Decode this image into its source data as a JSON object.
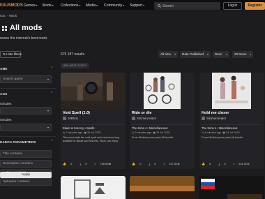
{
  "nav": {
    "logo": "EXUSMODS",
    "links": [
      "Games",
      "Mods",
      "Collections",
      "Media",
      "Community",
      "Support"
    ],
    "search_placeholder": "Search",
    "login": "Log in",
    "register": "Register"
  },
  "breadcrumb": [
    "ous",
    "Mods"
  ],
  "page": {
    "title": "All mods",
    "subtitle": "rowse the internet's best mods"
  },
  "toolbar": {
    "hide_filters": "Hide filters",
    "results": "675 187 results",
    "time": "All time",
    "sort_by": "Date Published",
    "order": "Desc",
    "per_page": "20 items"
  },
  "sidebar": {
    "game_label": "AME",
    "game_placeholder": "Search game",
    "tags_label": "AGS",
    "includes_1": "ncludes",
    "includes_2": "ncludes",
    "search_params_label": "EARCH PARAMETERS",
    "title_ph": "Title contains",
    "description_ph": "Description contains",
    "author_ph": "Author contains",
    "uploader_ph": "Uploader contains",
    "apply": "Apply"
  },
  "filter_chip": "Hide adult content",
  "cards": [
    {
      "title": "Void Spell (1.0)",
      "author": "10khtrix",
      "category": "Blade & Sorcery • Spells",
      "time": "2 minutes ago",
      "date": "24 Jul 2025",
      "desc": "This mod adds the void spell who has been long awaited for Blade and Sorcery. Hope you enjoy.",
      "endorse": "0",
      "downloads": "0",
      "size": "735.0MB"
    },
    {
      "title": "Ride or die",
      "author": "Simmercreator",
      "category": "The Sims 4 • Miscellaneous",
      "time": "3 minutes ago",
      "date": "24 Jul 2025",
      "desc": "From Mediolo pose pack #8 bundle",
      "endorse": "0",
      "downloads": "0",
      "size": "237.0KB"
    },
    {
      "title": "Hold me closer",
      "author": "Simmercreator",
      "category": "The Sims 4 • Miscellaneous",
      "time": "4 minutes ago",
      "date": "24 Jul 2025",
      "desc": "From Mediolo pose pack #8 bundle",
      "endorse": "0",
      "downloads": "0",
      "size": "241.0KB"
    }
  ],
  "colors": {
    "accent": "#d98f40",
    "background": "#1c1c1f",
    "card": "#232327"
  }
}
